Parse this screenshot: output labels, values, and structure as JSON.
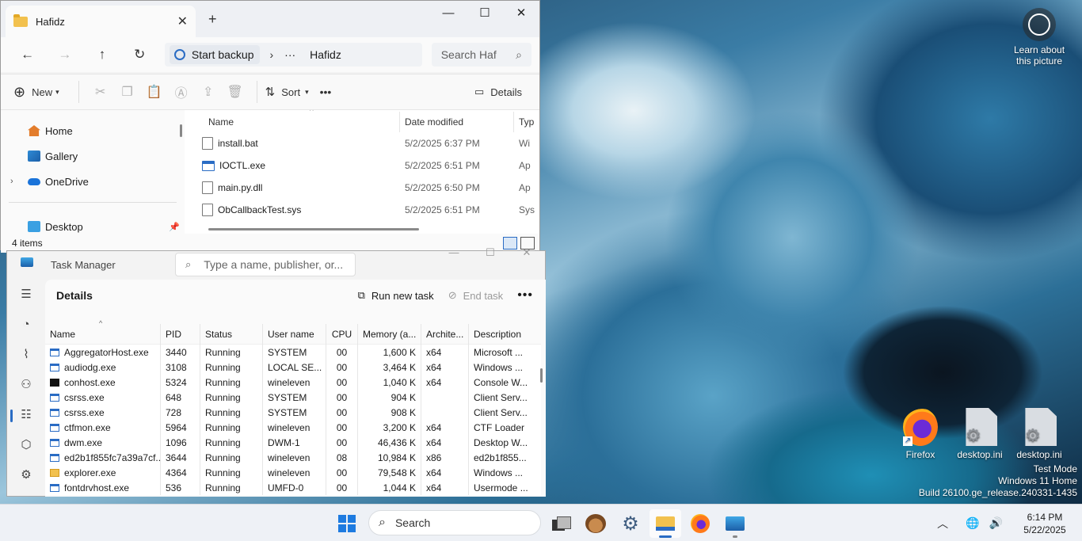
{
  "desktop": {
    "learn_picture": "Learn about this picture",
    "icons": [
      {
        "label": "Firefox",
        "icon": "firefox-icon"
      },
      {
        "label": "desktop.ini",
        "icon": "settings-file-icon"
      },
      {
        "label": "desktop.ini",
        "icon": "settings-file-icon"
      }
    ],
    "watermark": [
      "Test Mode",
      "Windows 11 Home",
      "Build 26100.ge_release.240331-1435"
    ]
  },
  "explorer": {
    "tab_title": "Hafidz",
    "address": {
      "backup_label": "Start backup",
      "more": "···",
      "folder": "Hafidz"
    },
    "search_placeholder": "Search Haf",
    "toolbar": {
      "new_label": "New",
      "sort_label": "Sort",
      "more": "•••",
      "details_label": "Details"
    },
    "nav": {
      "items": [
        {
          "label": "Home"
        },
        {
          "label": "Gallery"
        },
        {
          "label": "OneDrive"
        },
        {
          "label": "Desktop"
        }
      ]
    },
    "columns": {
      "name": "Name",
      "date": "Date modified",
      "type": "Typ"
    },
    "files": [
      {
        "name": "install.bat",
        "date": "5/2/2025 6:37 PM",
        "type": "Wi"
      },
      {
        "name": "IOCTL.exe",
        "date": "5/2/2025 6:51 PM",
        "type": "Ap"
      },
      {
        "name": "main.py.dll",
        "date": "5/2/2025 6:50 PM",
        "type": "Ap"
      },
      {
        "name": "ObCallbackTest.sys",
        "date": "5/2/2025 6:51 PM",
        "type": "Sys"
      }
    ],
    "status": "4 items"
  },
  "taskmgr": {
    "title": "Task Manager",
    "search_placeholder": "Type a name, publisher, or...",
    "page_title": "Details",
    "run_new_task": "Run new task",
    "end_task": "End task",
    "more": "•••",
    "columns": {
      "name": "Name",
      "pid": "PID",
      "status": "Status",
      "user": "User name",
      "cpu": "CPU",
      "memory": "Memory (a...",
      "arch": "Archite...",
      "desc": "Description"
    },
    "rows": [
      {
        "name": "AggregatorHost.exe",
        "pid": "3440",
        "status": "Running",
        "user": "SYSTEM",
        "cpu": "00",
        "memory": "1,600 K",
        "arch": "x64",
        "desc": "Microsoft ..."
      },
      {
        "name": "audiodg.exe",
        "pid": "3108",
        "status": "Running",
        "user": "LOCAL SE...",
        "cpu": "00",
        "memory": "3,464 K",
        "arch": "x64",
        "desc": "Windows ..."
      },
      {
        "name": "conhost.exe",
        "pid": "5324",
        "status": "Running",
        "user": "wineleven",
        "cpu": "00",
        "memory": "1,040 K",
        "arch": "x64",
        "desc": "Console W..."
      },
      {
        "name": "csrss.exe",
        "pid": "648",
        "status": "Running",
        "user": "SYSTEM",
        "cpu": "00",
        "memory": "904 K",
        "arch": "",
        "desc": "Client Serv..."
      },
      {
        "name": "csrss.exe",
        "pid": "728",
        "status": "Running",
        "user": "SYSTEM",
        "cpu": "00",
        "memory": "908 K",
        "arch": "",
        "desc": "Client Serv..."
      },
      {
        "name": "ctfmon.exe",
        "pid": "5964",
        "status": "Running",
        "user": "wineleven",
        "cpu": "00",
        "memory": "3,200 K",
        "arch": "x64",
        "desc": "CTF Loader"
      },
      {
        "name": "dwm.exe",
        "pid": "1096",
        "status": "Running",
        "user": "DWM-1",
        "cpu": "00",
        "memory": "46,436 K",
        "arch": "x64",
        "desc": "Desktop W..."
      },
      {
        "name": "ed2b1f855fc7a39a7cf...",
        "pid": "3644",
        "status": "Running",
        "user": "wineleven",
        "cpu": "08",
        "memory": "10,984 K",
        "arch": "x86",
        "desc": "ed2b1f855..."
      },
      {
        "name": "explorer.exe",
        "pid": "4364",
        "status": "Running",
        "user": "wineleven",
        "cpu": "00",
        "memory": "79,548 K",
        "arch": "x64",
        "desc": "Windows ..."
      },
      {
        "name": "fontdrvhost.exe",
        "pid": "536",
        "status": "Running",
        "user": "UMFD-0",
        "cpu": "00",
        "memory": "1,044 K",
        "arch": "x64",
        "desc": "Usermode ..."
      }
    ]
  },
  "taskbar": {
    "search_label": "Search",
    "time": "6:14 PM",
    "date": "5/22/2025"
  }
}
